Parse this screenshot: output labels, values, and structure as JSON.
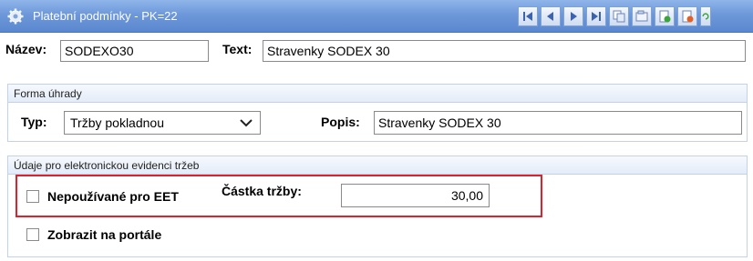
{
  "window": {
    "title": "Platební podmínky - PK=22",
    "icon": "gear-icon"
  },
  "toolbar": {
    "buttons": [
      {
        "name": "first-record-button",
        "icon": "first-icon"
      },
      {
        "name": "prev-record-button",
        "icon": "prev-icon"
      },
      {
        "name": "next-record-button",
        "icon": "next-icon"
      },
      {
        "name": "last-record-button",
        "icon": "last-icon"
      },
      {
        "name": "copy-button",
        "icon": "copy-icon"
      },
      {
        "name": "duplicate-button",
        "icon": "duplicate-icon"
      },
      {
        "name": "new-record-button",
        "icon": "new-icon"
      },
      {
        "name": "delete-record-button",
        "icon": "delete-icon"
      },
      {
        "name": "refresh-button",
        "icon": "refresh-icon"
      }
    ]
  },
  "record": {
    "name_label": "Název:",
    "name_value": "SODEXO30",
    "text_label": "Text:",
    "text_value": "Stravenky SODEX 30"
  },
  "payment_group": {
    "title": "Forma úhrady",
    "type_label": "Typ:",
    "type_value": "Tržby pokladnou",
    "desc_label": "Popis:",
    "desc_value": "Stravenky SODEX 30"
  },
  "eet_group": {
    "title": "Údaje pro elektronickou evidenci tržeb",
    "not_used_label": "Nepoužívané pro EET",
    "not_used_checked": false,
    "amount_label": "Částka tržby:",
    "amount_value": "30,00"
  },
  "portal": {
    "label": "Zobrazit na portále",
    "checked": false
  },
  "colors": {
    "titlebar": "#6d98d9",
    "highlight": "#e0202a",
    "group_border": "#c3d2e6"
  }
}
